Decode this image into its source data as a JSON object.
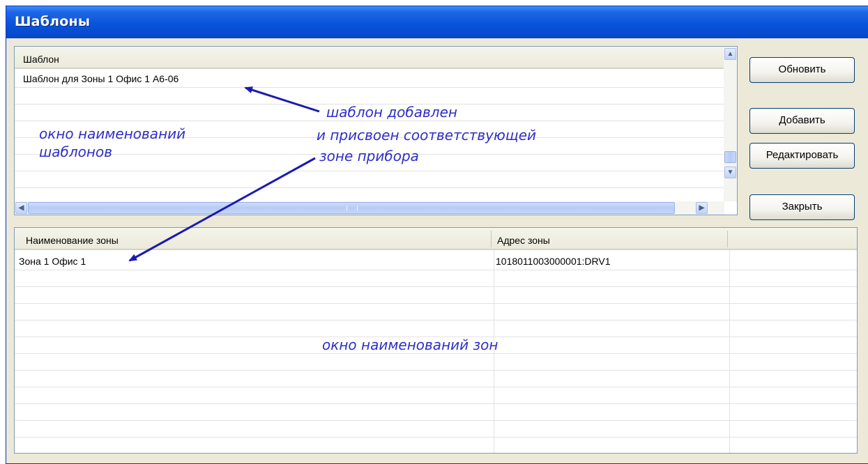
{
  "window": {
    "title": "Шаблоны"
  },
  "templates": {
    "header": "Шаблон",
    "rows": [
      "Шаблон для Зоны 1 Офис 1 А6-06"
    ]
  },
  "buttons": {
    "refresh": "Обновить",
    "add": "Добавить",
    "edit": "Редактировать",
    "close": "Закрыть"
  },
  "zones": {
    "headers": [
      "Наименование зоны",
      "Адрес зоны"
    ],
    "rows": [
      {
        "name": "Зона 1 Офис 1",
        "address": "1018011003000001:DRV1"
      }
    ]
  },
  "annotations": {
    "template_window_line1": "окно наименований",
    "template_window_line2": "шаблонов",
    "added_line1": "шаблон добавлен",
    "added_line2": "и присвоен соответствующей",
    "added_line3": "зоне прибора",
    "zone_window": "окно наименований зон"
  },
  "icons": {
    "scroll_up": "arrow-up-icon",
    "scroll_down": "arrow-down-icon",
    "scroll_left": "arrow-left-icon",
    "scroll_right": "arrow-right-icon"
  },
  "colors": {
    "titlebar": "#0a54dc",
    "annotation_text": "#2f2fc9",
    "annotation_arrow": "#1a1ab0",
    "button_border": "#003c74"
  }
}
